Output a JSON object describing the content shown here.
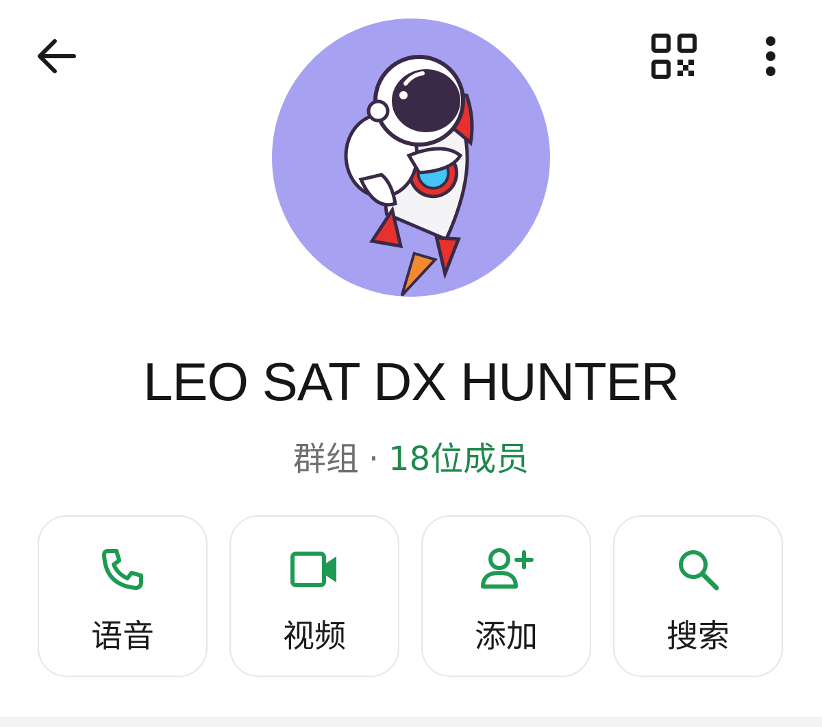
{
  "header": {
    "back_icon": "arrow-left-icon",
    "qr_icon": "qr-code-icon",
    "more_icon": "more-vertical-icon"
  },
  "profile": {
    "avatar_description_icon": "astronaut-rocket-avatar",
    "name": "LEO SAT DX HUNTER",
    "type_label": "群组",
    "separator": "·",
    "members_label": "18位成员"
  },
  "actions": [
    {
      "label": "语音",
      "icon": "phone-icon"
    },
    {
      "label": "视频",
      "icon": "video-camera-icon"
    },
    {
      "label": "添加",
      "icon": "add-person-icon"
    },
    {
      "label": "搜索",
      "icon": "search-icon"
    }
  ],
  "colors": {
    "accent_green": "#1f8a4c",
    "avatar_bg": "#a6a1f1",
    "text_dark": "#161616",
    "text_muted": "#6f6f6f"
  }
}
